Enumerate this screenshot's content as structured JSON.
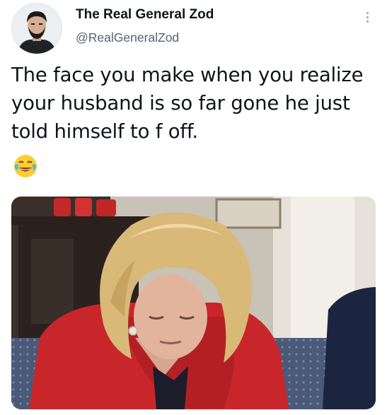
{
  "tweet": {
    "author": {
      "display_name": "The Real General Zod",
      "handle": "@RealGeneralZod",
      "avatar_icon": "profile-photo"
    },
    "text": "The face you make when you realize your husband is so far gone he just told himself to f off.",
    "emoji_icon": "face-with-tears-of-joy-emoji",
    "more_icon": "vertical-ellipsis-icon",
    "media_icon": "photo-woman-in-red-jacket"
  },
  "colors": {
    "text_primary": "#0f1419",
    "text_secondary": "#536471",
    "jacket_red": "#c8262b",
    "hair_blonde": "#d9b978"
  }
}
